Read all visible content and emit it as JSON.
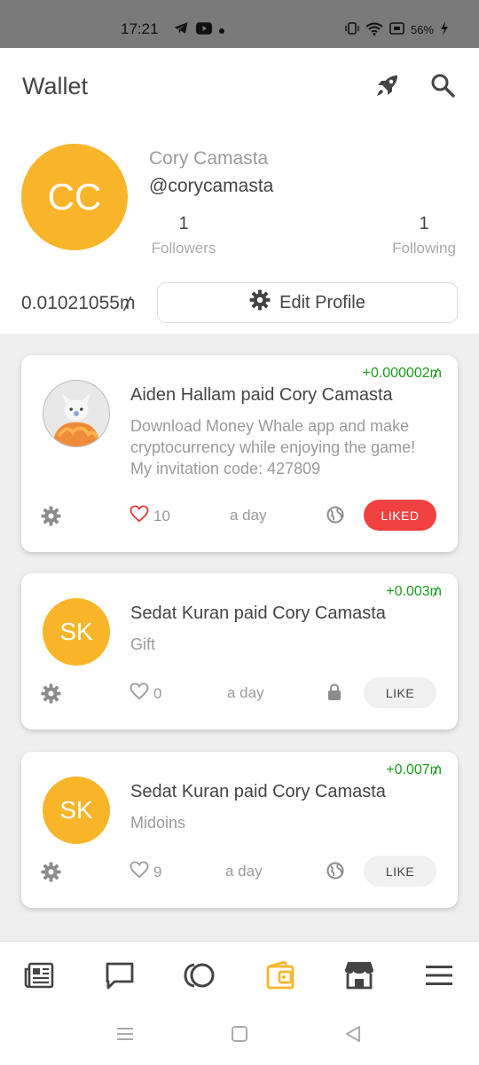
{
  "status_bar": {
    "time": "17:21",
    "battery": "56%",
    "icons": [
      "telegram-icon",
      "youtube-icon",
      "dot-icon",
      "vibrate-icon",
      "wifi-icon",
      "cast-icon",
      "battery-charging-icon"
    ]
  },
  "header": {
    "title": "Wallet",
    "icons": [
      "rocket-icon",
      "search-icon"
    ]
  },
  "profile": {
    "initials": "CC",
    "name": "Cory Camasta",
    "handle": "@corycamasta",
    "followers_count": "1",
    "followers_label": "Followers",
    "following_count": "1",
    "following_label": "Following",
    "balance": "0.01021055₥",
    "edit_label": "Edit Profile"
  },
  "feed": [
    {
      "amount": "+0.000002₥",
      "title": "Aiden Hallam paid Cory Camasta",
      "message": "Download Money Whale app and make cryptocurrency while enjoying the game! My invitation code: 427809",
      "likes": "10",
      "time": "a day",
      "visibility": "globe-icon",
      "button": "LIKED",
      "liked": true
    },
    {
      "amount": "+0.003₥",
      "initials": "SK",
      "title": "Sedat Kuran paid Cory Camasta",
      "message": "Gift",
      "likes": "0",
      "time": "a day",
      "visibility": "lock-icon",
      "button": "LIKE",
      "liked": false
    },
    {
      "amount": "+0.007₥",
      "initials": "SK",
      "title": "Sedat Kuran paid Cory Camasta",
      "message": "Midoins",
      "likes": "9",
      "time": "a day",
      "visibility": "globe-icon",
      "button": "LIKE",
      "liked": false
    }
  ],
  "colors": {
    "accent": "#f9b52a",
    "positive": "#1c9a1c",
    "liked": "#f24141"
  },
  "bottom_nav": [
    "news-icon",
    "chat-icon",
    "coins-icon",
    "wallet-icon",
    "store-icon",
    "menu-icon"
  ],
  "bottom_nav_active": "wallet-icon",
  "system_nav": [
    "recents-icon",
    "home-icon",
    "back-icon"
  ]
}
